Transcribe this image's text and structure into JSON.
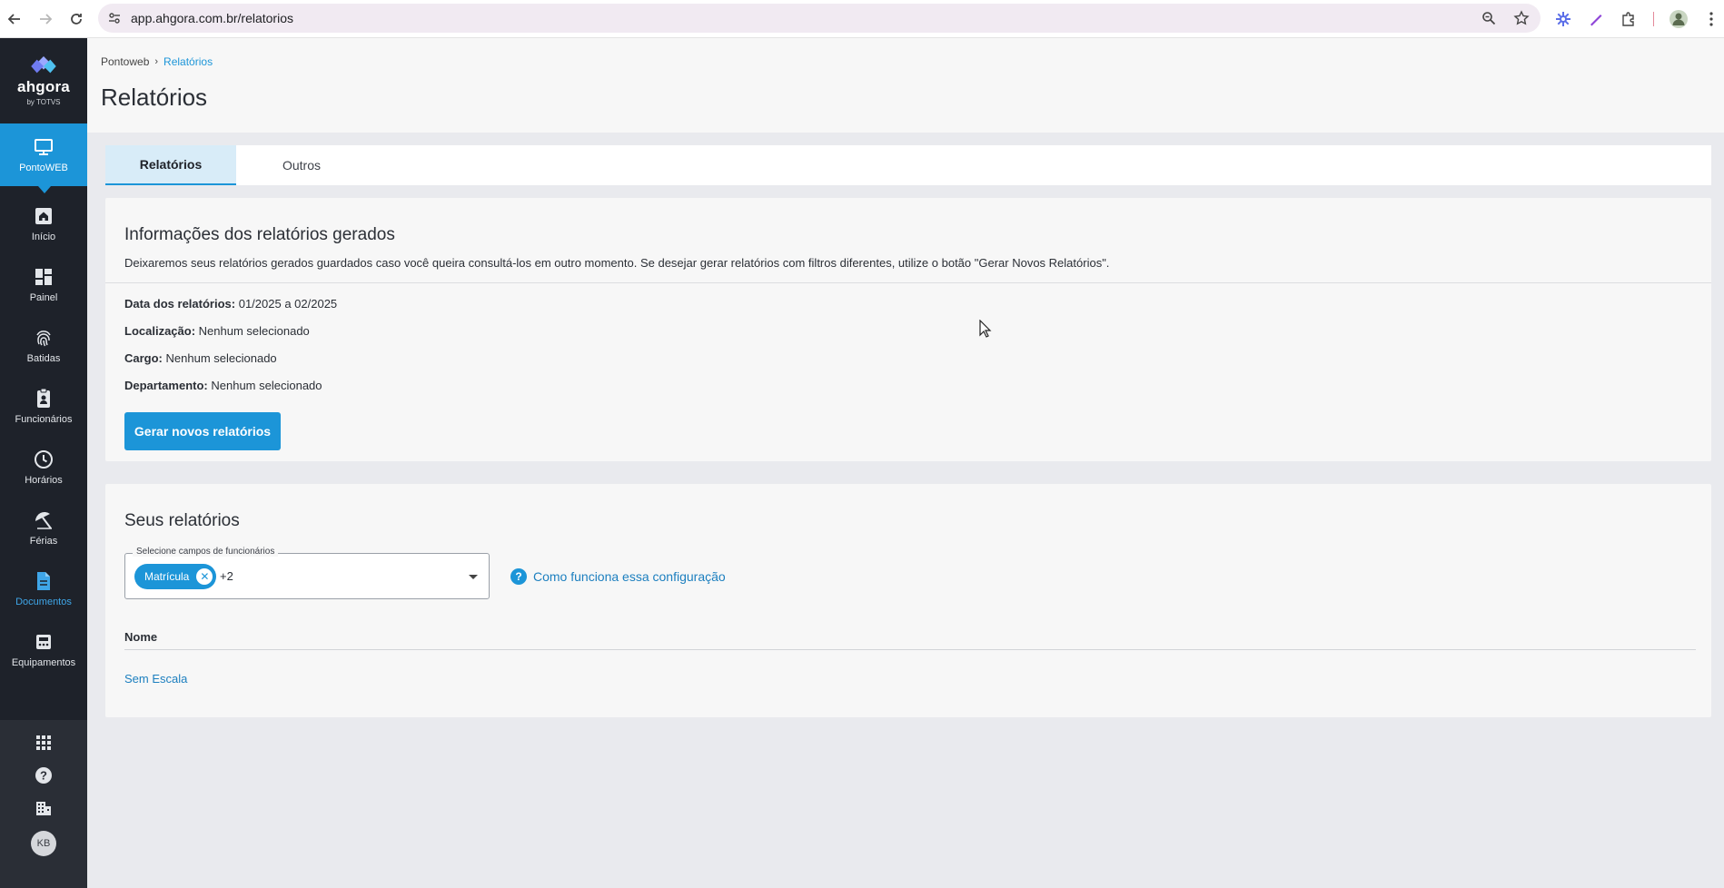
{
  "browser": {
    "url": "app.ahgora.com.br/relatorios"
  },
  "sidebar": {
    "logo_name": "ahgora",
    "logo_by": "by TOTVS",
    "items": [
      {
        "label": "PontoWEB",
        "icon": "monitor-icon"
      },
      {
        "label": "Início",
        "icon": "home-icon"
      },
      {
        "label": "Painel",
        "icon": "dashboard-icon"
      },
      {
        "label": "Batidas",
        "icon": "fingerprint-icon"
      },
      {
        "label": "Funcionários",
        "icon": "badge-icon"
      },
      {
        "label": "Horários",
        "icon": "clock-icon"
      },
      {
        "label": "Férias",
        "icon": "umbrella-icon"
      },
      {
        "label": "Documentos",
        "icon": "document-icon"
      },
      {
        "label": "Equipamentos",
        "icon": "device-icon"
      }
    ],
    "avatar_initials": "KB"
  },
  "header": {
    "breadcrumb": [
      "Pontoweb",
      "Relatórios"
    ],
    "title": "Relatórios"
  },
  "tabs": [
    "Relatórios",
    "Outros"
  ],
  "info_card": {
    "title": "Informações dos relatórios gerados",
    "description": "Deixaremos seus relatórios gerados guardados caso você queira consultá-los em outro momento. Se desejar gerar relatórios com filtros diferentes, utilize o botão \"Gerar Novos Relatórios\".",
    "rows": [
      {
        "label": "Data dos relatórios:",
        "value": "01/2025 a 02/2025"
      },
      {
        "label": "Localização:",
        "value": "Nenhum selecionado"
      },
      {
        "label": "Cargo:",
        "value": "Nenhum selecionado"
      },
      {
        "label": "Departamento:",
        "value": "Nenhum selecionado"
      }
    ],
    "button": "Gerar novos relatórios"
  },
  "reports_card": {
    "title": "Seus relatórios",
    "select_label": "Selecione campos de funcionários",
    "chip": "Matrícula",
    "more": "+2",
    "help": "Como funciona essa configuração",
    "column": "Nome",
    "rows": [
      "Sem Escala"
    ]
  },
  "colors": {
    "accent": "#1c95d8",
    "sidebar": "#1e222a"
  }
}
